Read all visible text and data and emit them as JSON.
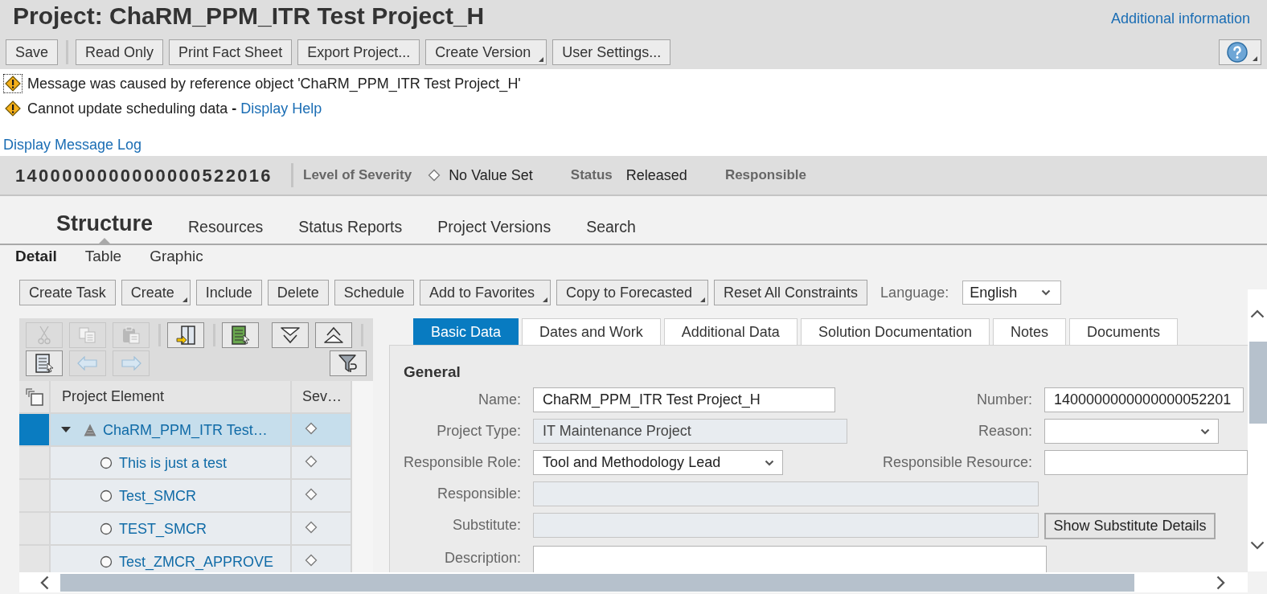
{
  "header": {
    "title": "Project: ChaRM_PPM_ITR Test Project_H",
    "info_link": "Additional information"
  },
  "toolbar": {
    "buttons": [
      {
        "label": "Save",
        "has_menu": false,
        "separator_after": true
      },
      {
        "label": "Read Only",
        "has_menu": false,
        "separator_after": false
      },
      {
        "label": "Print Fact Sheet",
        "has_menu": false,
        "separator_after": false
      },
      {
        "label": "Export Project...",
        "has_menu": false,
        "separator_after": false
      },
      {
        "label": "Create Version",
        "has_menu": true,
        "separator_after": false
      },
      {
        "label": "User Settings...",
        "has_menu": false,
        "separator_after": false
      }
    ],
    "help_button": {
      "has_menu": true
    }
  },
  "messages": [
    {
      "kind": "warning",
      "focused": true,
      "text": "Message was caused by reference object 'ChaRM_PPM_ITR Test Project_H'"
    },
    {
      "kind": "warning",
      "focused": false,
      "text": "Cannot update scheduling data **-**",
      "link": "Display Help"
    }
  ],
  "message_log_link": "Display Message Log",
  "object_header": {
    "number": "1400000000000000522016",
    "attributes": [
      {
        "label": "Level of Severity",
        "has_icon": true,
        "value": "No Value Set"
      },
      {
        "label": "Status",
        "has_icon": false,
        "value": "Released"
      },
      {
        "label": "Responsible",
        "has_icon": false
      }
    ]
  },
  "main_tabs": [
    {
      "label": "Structure",
      "selected": true
    },
    {
      "label": "Resources",
      "selected": false
    },
    {
      "label": "Status Reports",
      "selected": false
    },
    {
      "label": "Project Versions",
      "selected": false
    },
    {
      "label": "Search",
      "selected": false
    }
  ],
  "sub_tabs": [
    {
      "label": "Detail",
      "selected": true
    },
    {
      "label": "Table",
      "selected": false
    },
    {
      "label": "Graphic",
      "selected": false
    }
  ],
  "action_bar": {
    "buttons": [
      {
        "label": "Create Task",
        "has_menu": false
      },
      {
        "label": "Create",
        "has_menu": true
      },
      {
        "label": "Include",
        "has_menu": false
      },
      {
        "label": "Delete",
        "has_menu": false
      },
      {
        "label": "Schedule",
        "has_menu": false
      },
      {
        "label": "Add to Favorites",
        "has_menu": true
      },
      {
        "label": "Copy to Forecasted",
        "has_menu": true
      },
      {
        "label": "Reset All Constraints",
        "has_menu": false
      }
    ],
    "language": {
      "label": "Language:",
      "value": "English"
    }
  },
  "tree": {
    "toolbar_rows": [
      [
        {
          "kind": "cut",
          "disabled": true
        },
        {
          "kind": "copy",
          "disabled": true
        },
        {
          "kind": "paste",
          "disabled": true
        },
        {
          "kind": "separator"
        },
        {
          "kind": "insert",
          "disabled": false
        },
        {
          "kind": "separator"
        },
        {
          "kind": "export",
          "disabled": false
        },
        {
          "kind": "expand_all",
          "disabled": false
        },
        {
          "kind": "collapse_all",
          "disabled": false
        },
        {
          "kind": "separator"
        }
      ],
      [
        {
          "kind": "details",
          "disabled": false
        },
        {
          "kind": "back",
          "disabled": true
        },
        {
          "kind": "forward",
          "disabled": true
        },
        {
          "kind": "filter",
          "disabled": false
        }
      ]
    ],
    "columns": [
      "Project Element",
      "Sev…"
    ],
    "rows": [
      {
        "kind": "project",
        "label": "ChaRM_PPM_ITR Test…",
        "selected": true,
        "expanded": true,
        "children": [
          {
            "kind": "task",
            "label": "This is just a test",
            "selected": false
          },
          {
            "kind": "task",
            "label": "Test_SMCR",
            "selected": false
          },
          {
            "kind": "task",
            "label": "TEST_SMCR",
            "selected": false
          },
          {
            "kind": "task",
            "label": "Test_ZMCR_APPROVE",
            "selected": false
          }
        ]
      }
    ]
  },
  "detail_tabs": [
    {
      "label": "Basic Data",
      "selected": true
    },
    {
      "label": "Dates and Work",
      "selected": false
    },
    {
      "label": "Additional Data",
      "selected": false
    },
    {
      "label": "Solution Documentation",
      "selected": false
    },
    {
      "label": "Notes",
      "selected": false
    },
    {
      "label": "Documents",
      "selected": false
    }
  ],
  "form": {
    "section": "General",
    "rows": [
      {
        "left": {
          "kind": "input",
          "label": "Name:",
          "value": "ChaRM_PPM_ITR Test Project_H",
          "disabled": false
        },
        "right": {
          "kind": "input",
          "label": "Number:",
          "value": "1400000000000000052201",
          "disabled": false
        }
      },
      {
        "left": {
          "kind": "input",
          "label": "Project Type:",
          "value": "IT Maintenance Project",
          "disabled": true
        },
        "right": {
          "kind": "select",
          "label": "Reason:"
        }
      },
      {
        "left": {
          "kind": "select",
          "label": "Responsible Role:",
          "value": "Tool and Methodology Lead"
        },
        "right": {
          "kind": "input",
          "label": "Responsible Resource:",
          "disabled": false
        }
      },
      {
        "left": {
          "kind": "input",
          "label": "Responsible:",
          "disabled": true
        }
      },
      {
        "left": {
          "kind": "input",
          "label": "Substitute:",
          "disabled": true
        },
        "right": {
          "kind": "button",
          "label": "Show Substitute Details"
        }
      },
      {
        "left": {
          "kind": "textarea",
          "label": "Description:",
          "disabled": false
        }
      }
    ]
  }
}
